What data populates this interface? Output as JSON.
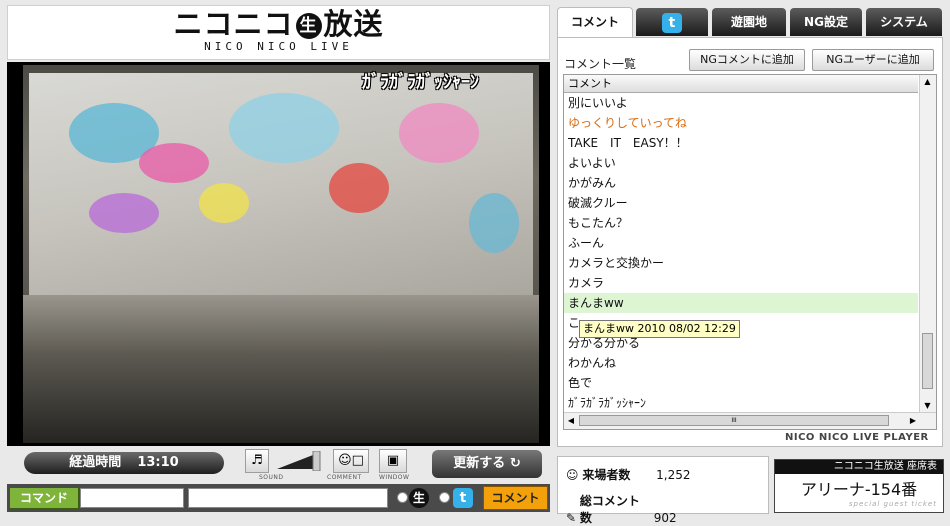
{
  "logo": {
    "main_left": "ニコニコ",
    "nama": "生",
    "main_right": "放送",
    "sub": "NICO NICO LIVE"
  },
  "video": {
    "overlay_title": "ｶﾞﾗｶﾞﾗｶﾞｯｼｬｰﾝ"
  },
  "controls": {
    "elapsed_label": "経過時間",
    "elapsed_value": "13:10",
    "sound_caption": "SOUND",
    "comment_caption": "COMMENT",
    "window_caption": "WINDOW",
    "refresh_label": "更新する"
  },
  "command_bar": {
    "command_label": "コマンド",
    "send_label": "コメント",
    "nama": "生"
  },
  "tabs": [
    {
      "label": "コメント",
      "active": true
    },
    {
      "label": "t",
      "icon": "twitter-icon"
    },
    {
      "label": "遊園地"
    },
    {
      "label": "NG設定"
    },
    {
      "label": "システム"
    }
  ],
  "comment_panel": {
    "title": "コメント一覧",
    "ng_comment_button": "NGコメントに追加",
    "ng_user_button": "NGユーザーに追加",
    "column_header": "コメント",
    "comments": [
      {
        "text": "別にいいよ"
      },
      {
        "text": "ゆっくりしていってね",
        "color": "#d86c12"
      },
      {
        "text": "TAKE　IT　EASY！！"
      },
      {
        "text": "よいよい"
      },
      {
        "text": "かがみん"
      },
      {
        "text": "破滅クルー"
      },
      {
        "text": "もこたん？"
      },
      {
        "text": "ふーん"
      },
      {
        "text": "カメラと交換かー"
      },
      {
        "text": "カメラ"
      },
      {
        "text": "まんまww",
        "highlight": true
      },
      {
        "text": "こ"
      },
      {
        "text": "分かる分かる"
      },
      {
        "text": "わかんね"
      },
      {
        "text": "色で"
      },
      {
        "text": "ｶﾞﾗｶﾞﾗｶﾞｯｼｬｰﾝ"
      }
    ],
    "tooltip": "まんまww 2010 08/02 12:29",
    "hscroll_thumb": "III"
  },
  "player_label": "NICO NICO LIVE PLAYER",
  "stats": {
    "visitors_label": "来場者数",
    "visitors_value": "1,252",
    "comments_label": "総コメント数",
    "comments_value": "902"
  },
  "ticket": {
    "header": "ニコニコ生放送 座席表",
    "seat": "アリーナ-154番",
    "footer": "special guest ticket"
  },
  "colors": {
    "accent_orange": "#f2a10a",
    "command_green": "#7fb43a",
    "highlight_row": "#ddf5d3",
    "twitter_blue": "#36b0e8"
  }
}
